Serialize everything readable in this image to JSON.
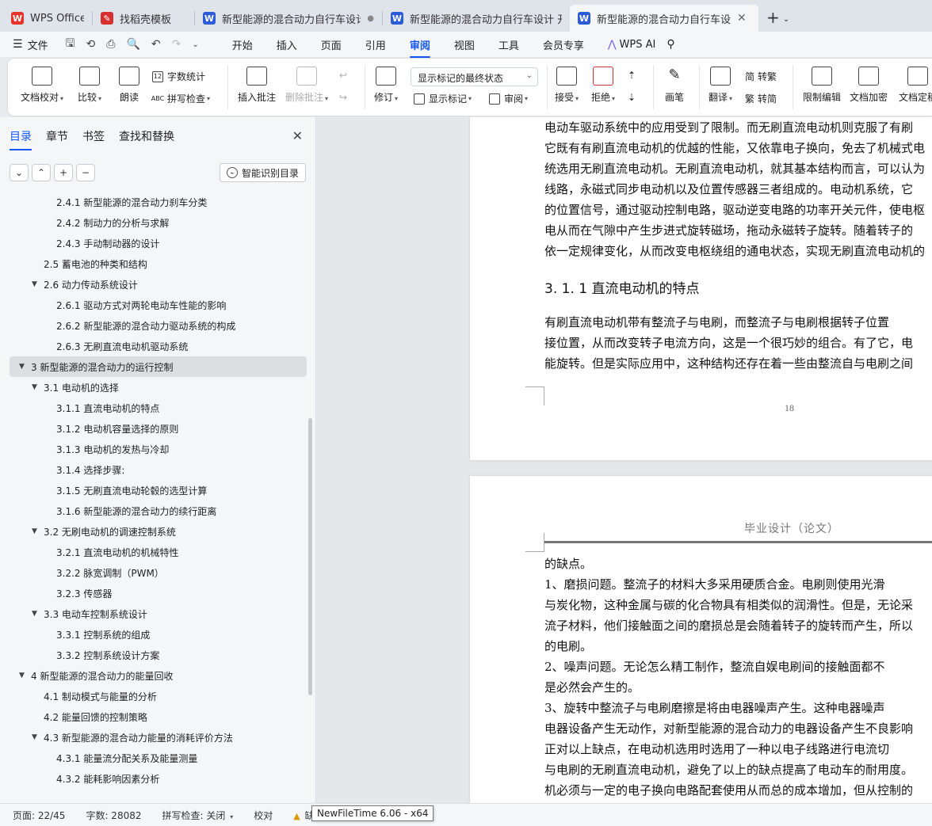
{
  "tabs": [
    {
      "label": "WPS Office",
      "icon": "wps-logo-icon",
      "color": "#e8332a"
    },
    {
      "label": "找稻壳模板",
      "icon": "docer-logo-icon",
      "color": "#d62f2f"
    },
    {
      "label": "新型能源的混合动力自行车设计 任",
      "icon": "word-doc-icon",
      "color": "#2b5bd7",
      "indicator": "●"
    },
    {
      "label": "新型能源的混合动力自行车设计 开题",
      "icon": "word-doc-icon",
      "color": "#2b5bd7"
    },
    {
      "label": "新型能源的混合动力自行车设",
      "icon": "word-doc-icon",
      "color": "#2b5bd7",
      "active": true
    }
  ],
  "menubar": {
    "file": "文件",
    "items": [
      "开始",
      "插入",
      "页面",
      "引用",
      "审阅",
      "视图",
      "工具",
      "会员专享"
    ],
    "active": "审阅",
    "wps_ai": "WPS AI"
  },
  "ribbon": {
    "doc_check": "文档校对",
    "compare": "比较",
    "read_aloud": "朗读",
    "word_count": "字数统计",
    "spell_check": "拼写检查",
    "insert_comment": "插入批注",
    "delete_comment": "删除批注",
    "revise": "修订",
    "markup_select": "显示标记的最终状态",
    "show_markup": "显示标记",
    "review": "审阅",
    "accept": "接受",
    "reject": "拒绝",
    "pen": "画笔",
    "translate": "翻译",
    "to_traditional": "转繁",
    "to_simplified": "转简",
    "restrict_edit": "限制编辑",
    "encrypt": "文档加密",
    "doc_final": "文档定稿"
  },
  "sidebar": {
    "tabs": [
      "目录",
      "章节",
      "书签",
      "查找和替换"
    ],
    "active_tab": "目录",
    "smart_toc": "智能识别目录",
    "toc": [
      {
        "level": 3,
        "text": "2.4.1  新型能源的混合动力刹车分类"
      },
      {
        "level": 3,
        "text": "2.4.2  制动力的分析与求解"
      },
      {
        "level": 3,
        "text": "2.4.3  手动制动器的设计"
      },
      {
        "level": 2,
        "text": "2.5  蓄电池的种类和结构"
      },
      {
        "level": 2,
        "text": "2.6  动力传动系统设计",
        "expanded": true
      },
      {
        "level": 3,
        "text": "2.6.1  驱动方式对两轮电动车性能的影响"
      },
      {
        "level": 3,
        "text": "2.6.2  新型能源的混合动力驱动系统的构成"
      },
      {
        "level": 3,
        "text": "2.6.3  无刷直流电动机驱动系统"
      },
      {
        "level": 1,
        "text": "3  新型能源的混合动力的运行控制",
        "expanded": true,
        "selected": true
      },
      {
        "level": 2,
        "text": "3.1  电动机的选择",
        "expanded": true
      },
      {
        "level": 3,
        "text": "3.1.1  直流电动机的特点"
      },
      {
        "level": 3,
        "text": "3.1.2  电动机容量选择的原则"
      },
      {
        "level": 3,
        "text": "3.1.3  电动机的发热与冷却"
      },
      {
        "level": 3,
        "text": "3.1.4  选择步骤:"
      },
      {
        "level": 3,
        "text": "3.1.5  无刷直流电动轮毂的选型计算"
      },
      {
        "level": 3,
        "text": "3.1.6  新型能源的混合动力的续行距离"
      },
      {
        "level": 2,
        "text": "3.2  无刷电动机的调速控制系统",
        "expanded": true
      },
      {
        "level": 3,
        "text": "3.2.1  直流电动机的机械特性"
      },
      {
        "level": 3,
        "text": "3.2.2  脉宽调制（PWM）"
      },
      {
        "level": 3,
        "text": "3.2.3  传感器"
      },
      {
        "level": 2,
        "text": "3.3  电动车控制系统设计",
        "expanded": true
      },
      {
        "level": 3,
        "text": "3.3.1  控制系统的组成"
      },
      {
        "level": 3,
        "text": "3.3.2  控制系统设计方案"
      },
      {
        "level": 1,
        "text": "4  新型能源的混合动力的能量回收",
        "expanded": true
      },
      {
        "level": 2,
        "text": "4.1  制动模式与能量的分析"
      },
      {
        "level": 2,
        "text": "4.2  能量回馈的控制策略"
      },
      {
        "level": 2,
        "text": "4.3  新型能源的混合动力能量的消耗评价方法",
        "expanded": true
      },
      {
        "level": 3,
        "text": "4.3.1  能量流分配关系及能量测量"
      },
      {
        "level": 3,
        "text": "4.3.2  能耗影响因素分析"
      }
    ]
  },
  "document": {
    "page1_lines": [
      "电动车驱动系统中的应用受到了限制。而无刷直流电动机则克服了有刷",
      "它既有有刷直流电动机的优越的性能，又依靠电子换向，免去了机械式电",
      "统选用无刷直流电动机。无刷直流电动机，就其基本结构而言，可以认为",
      "线路，永磁式同步电动机以及位置传感器三者组成的。电动机系统，它",
      "的位置信号，通过驱动控制电路，驱动逆变电路的功率开关元件，使电枢",
      "电从而在气隙中产生步进式旋转磁场，拖动永磁转子旋转。随着转子的",
      "依一定规律变化，从而改变电枢绕组的通电状态，实现无刷直流电动机的"
    ],
    "heading": "3. 1. 1  直流电动机的特点",
    "page1_para2": [
      "    有刷直流电动机带有整流子与电刷，而整流子与电刷根据转子位置",
      "接位置，从而改变转子电流方向，这是一个很巧妙的组合。有了它，电",
      "能旋转。但是实际应用中，这种结构还存在着一些由整流自与电刷之间"
    ],
    "page_number": "18",
    "page2_header": "毕业设计（论文）",
    "page2_lines": [
      "的缺点。",
      "    1、磨损问题。整流子的材料大多采用硬质合金。电刷则使用光滑",
      "与炭化物，这种金属与碳的化合物具有相类似的润滑性。但是，无论采",
      "流子材料，他们接触面之间的磨损总是会随着转子的旋转而产生，所以",
      "的电刷。",
      "    2、噪声问题。无论怎么精工制作，整流自娱电刷间的接触面都不",
      "是必然会产生的。",
      "    3、旋转中整流子与电刷磨擦是将由电器噪声产生。这种电器噪声",
      "电器设备产生无动作，对新型能源的混合动力的电器设备产生不良影响",
      "    正对以上缺点，在电动机选用时选用了一种以电子线路进行电流切",
      "与电刷的无刷直流电动机，避免了以上的缺点提高了电动车的耐用度。",
      "机必须与一定的电子换向电路配套使用从而总的成本增加，但从控制的"
    ]
  },
  "statusbar": {
    "page": "页面: 22/45",
    "words": "字数: 28082",
    "spell": "拼写检查: 关闭",
    "proof": "校对",
    "warn_label": "缺"
  },
  "tooltip": "NewFileTime 6.06 - x64"
}
